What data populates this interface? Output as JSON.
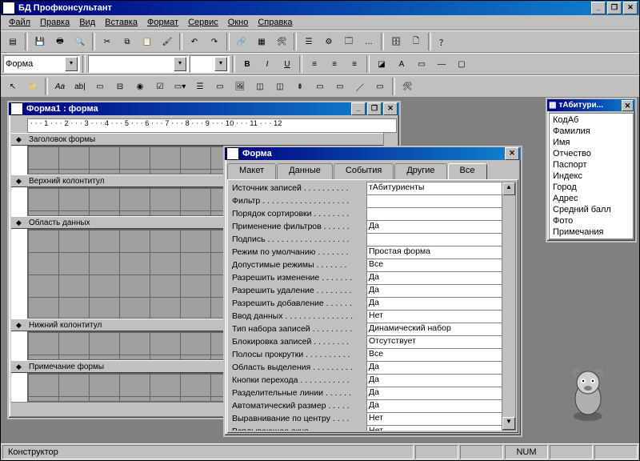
{
  "titlebar": {
    "icon": "key-icon",
    "title": "БД Профконсультант"
  },
  "menus": [
    "Файл",
    "Правка",
    "Вид",
    "Вставка",
    "Формат",
    "Сервис",
    "Окно",
    "Справка"
  ],
  "combo_object": "Форма",
  "mdi": {
    "title": "Форма1 : форма",
    "ruler": "⋅ ⋅ ⋅ 1 ⋅ ⋅ ⋅ 2 ⋅ ⋅ ⋅ 3 ⋅ ⋅ ⋅ 4 ⋅ ⋅ ⋅ 5 ⋅ ⋅ ⋅ 6 ⋅ ⋅ ⋅ 7 ⋅ ⋅ ⋅ 8 ⋅ ⋅ ⋅ 9 ⋅ ⋅ ⋅ 10 ⋅ ⋅ ⋅ 11 ⋅ ⋅ ⋅ 12",
    "sections": [
      "Заголовок формы",
      "Верхний колонтитул",
      "Область данных",
      "Нижний колонтитул",
      "Примечание формы"
    ]
  },
  "properties": {
    "title": "Форма",
    "tabs": [
      "Макет",
      "Данные",
      "События",
      "Другие",
      "Все"
    ],
    "active_tab": 4,
    "rows": [
      {
        "k": "Источник записей . . . . . . . . . .",
        "v": "тАбитуриенты"
      },
      {
        "k": "Фильтр . . . . . . . . . . . . . . . . . . .",
        "v": ""
      },
      {
        "k": "Порядок сортировки . . . . . . . .",
        "v": ""
      },
      {
        "k": "Применение фильтров . . . . . .",
        "v": "Да"
      },
      {
        "k": "Подпись . . . . . . . . . . . . . . . . . .",
        "v": ""
      },
      {
        "k": "Режим по умолчанию . . . . . . .",
        "v": "Простая форма"
      },
      {
        "k": "Допустимые режимы . . . . . . .",
        "v": "Все"
      },
      {
        "k": "Разрешить изменение . . . . . . .",
        "v": "Да"
      },
      {
        "k": "Разрешить удаление . . . . . . . .",
        "v": "Да"
      },
      {
        "k": "Разрешить добавление . . . . . .",
        "v": "Да"
      },
      {
        "k": "Ввод данных . . . . . . . . . . . . . . .",
        "v": "Нет"
      },
      {
        "k": "Тип набора записей . . . . . . . . .",
        "v": "Динамический набор"
      },
      {
        "k": "Блокировка записей . . . . . . . .",
        "v": "Отсутствует"
      },
      {
        "k": "Полосы прокрутки . . . . . . . . . .",
        "v": "Все"
      },
      {
        "k": "Область выделения . . . . . . . . .",
        "v": "Да"
      },
      {
        "k": "Кнопки перехода . . . . . . . . . . .",
        "v": "Да"
      },
      {
        "k": "Разделительные линии . . . . . .",
        "v": "Да"
      },
      {
        "k": "Автоматический размер . . . . .",
        "v": "Да"
      },
      {
        "k": "Выравнивание по центру . . . .",
        "v": "Нет"
      },
      {
        "k": "Всплывающее окно . . . . . . . . .",
        "v": "Нет"
      }
    ]
  },
  "fieldlist": {
    "title": "тАбитури...",
    "items": [
      "КодАб",
      "Фамилия",
      "Имя",
      "Отчество",
      "Паспорт",
      "Индекс",
      "Город",
      "Адрес",
      "Средний балл",
      "Фото",
      "Примечания"
    ]
  },
  "statusbar": {
    "mode": "Конструктор",
    "num": "NUM"
  }
}
